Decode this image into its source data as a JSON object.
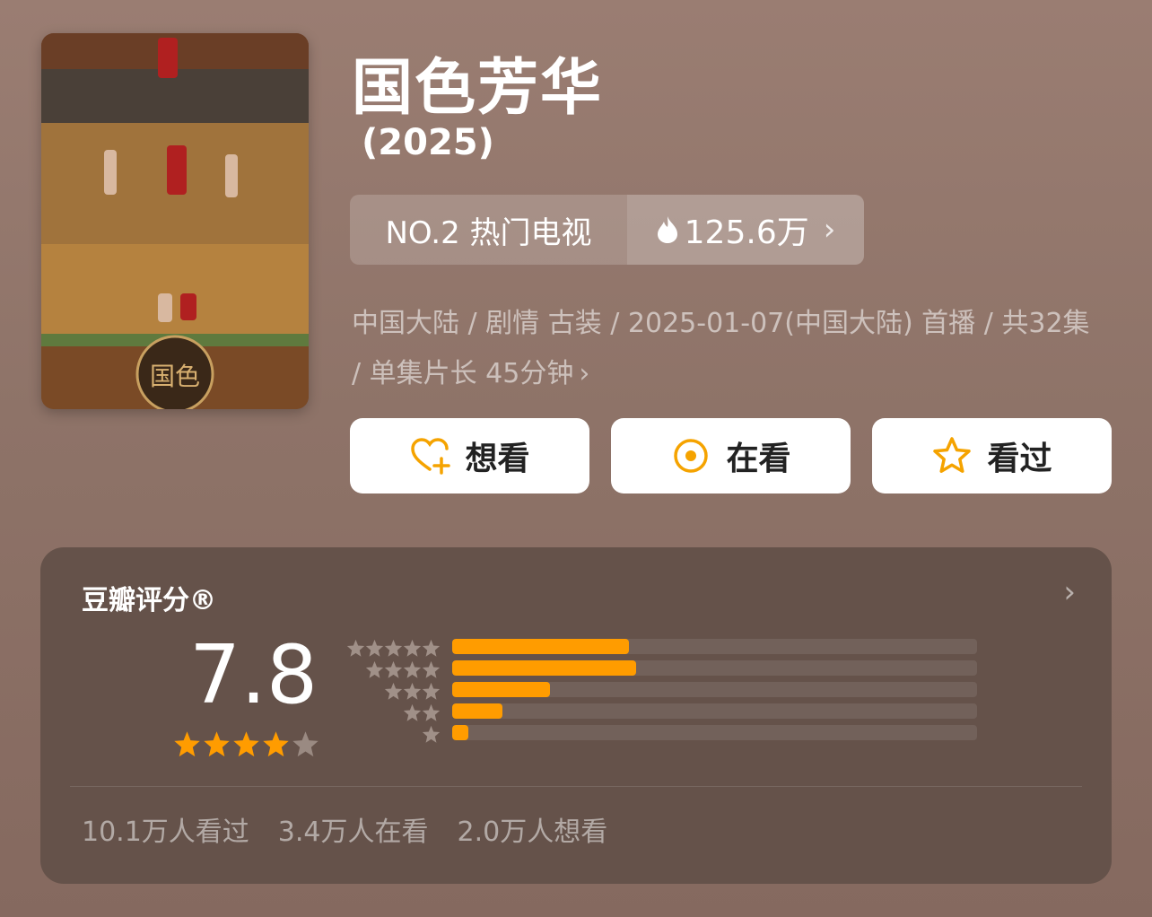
{
  "show": {
    "title": "国色芳华",
    "year": "(2025)"
  },
  "rank": {
    "label": "NO.2 热门电视",
    "heat": "125.6万",
    "heat_icon": "flame-icon"
  },
  "meta": {
    "line": "中国大陆 / 剧情 古装 / 2025-01-07(中国大陆) 首播 / 共32集 / 单集片长 45分钟"
  },
  "actions": [
    {
      "label": "想看",
      "icon": "heart-plus-icon"
    },
    {
      "label": "在看",
      "icon": "target-icon"
    },
    {
      "label": "看过",
      "icon": "star-outline-icon"
    }
  ],
  "rating": {
    "title": "豆瓣评分®",
    "score": "7.8",
    "star_level": 4,
    "distribution": [
      {
        "stars": 5,
        "fraction": 0.337
      },
      {
        "stars": 4,
        "fraction": 0.35
      },
      {
        "stars": 3,
        "fraction": 0.187
      },
      {
        "stars": 2,
        "fraction": 0.096
      },
      {
        "stars": 1,
        "fraction": 0.03
      }
    ],
    "stats": [
      "10.1万人看过",
      "3.4万人在看",
      "2.0万人想看"
    ]
  },
  "colors": {
    "accent": "#ff9c00",
    "card": "#65524a"
  }
}
